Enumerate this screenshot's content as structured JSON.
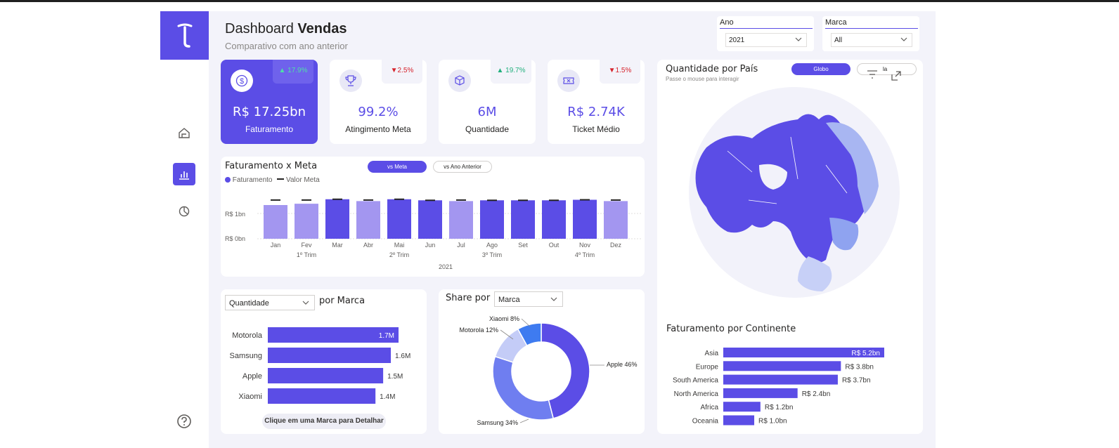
{
  "header": {
    "title_light": "Dashboard",
    "title_bold": "Vendas",
    "subtitle": "Comparativo com ano anterior"
  },
  "filters": {
    "ano": {
      "label": "Ano",
      "value": "2021"
    },
    "marca": {
      "label": "Marca",
      "value": "All"
    }
  },
  "nav": {
    "items": [
      "home-icon",
      "bar-chart-icon",
      "pie-chart-icon"
    ],
    "active": "bar-chart-icon",
    "help": "help-icon"
  },
  "kpis": [
    {
      "value": "R$ 17.25bn",
      "name": "Faturamento",
      "delta": "17.9%",
      "direction": "up",
      "icon": "dollar-icon"
    },
    {
      "value": "99.2%",
      "name": "Atingimento Meta",
      "delta": "2.5%",
      "direction": "down",
      "icon": "trophy-icon"
    },
    {
      "value": "6M",
      "name": "Quantidade",
      "delta": "19.7%",
      "direction": "up",
      "icon": "box-icon"
    },
    {
      "value": "R$ 2.74K",
      "name": "Ticket Médio",
      "delta": "1.5%",
      "direction": "down",
      "icon": "ticket-icon"
    }
  ],
  "colors": {
    "accent": "#5b4de6",
    "accent_light": "#a396f0",
    "up": "#22b07d",
    "down": "#d6232c"
  },
  "fat_meta": {
    "title": "Faturamento x Meta",
    "tab_active": "vs Meta",
    "tab_inactive": "vs Ano Anterior",
    "legend_fat": "Faturamento",
    "legend_meta": "Valor Meta",
    "y_ticks": [
      "R$ 1bn",
      "R$ 0bn"
    ],
    "quarters": [
      "1º Trim",
      "2º Trim",
      "3º Trim",
      "4º Trim"
    ],
    "year": "2021"
  },
  "marca": {
    "dropdown": "Quantidade",
    "title": "por Marca",
    "hint": "Clique em uma Marca para Detalhar"
  },
  "share": {
    "title": "Share por",
    "dropdown": "Marca"
  },
  "map": {
    "title": "Quantidade por País",
    "subtitle": "Passe o mouse para interagir",
    "tab_active": "Globo",
    "tab_inactive": "la"
  },
  "continente": {
    "title": "Faturamento por Continente"
  },
  "chart_data": [
    {
      "type": "bar",
      "title": "Faturamento x Meta",
      "categories": [
        "Jan",
        "Fev",
        "Mar",
        "Abr",
        "Mai",
        "Jun",
        "Jul",
        "Ago",
        "Set",
        "Out",
        "Nov",
        "Dez"
      ],
      "series": [
        {
          "name": "Faturamento",
          "values": [
            1.28,
            1.33,
            1.5,
            1.43,
            1.5,
            1.46,
            1.43,
            1.46,
            1.46,
            1.46,
            1.48,
            1.43
          ]
        },
        {
          "name": "Valor Meta",
          "values": [
            1.47,
            1.47,
            1.5,
            1.47,
            1.5,
            1.46,
            1.47,
            1.46,
            1.46,
            1.46,
            1.48,
            1.47
          ]
        }
      ],
      "highlight": [
        false,
        false,
        true,
        false,
        true,
        true,
        false,
        true,
        true,
        true,
        true,
        false
      ],
      "y_ticks": [
        "R$ 1bn",
        "R$ 0bn"
      ],
      "ylim": [
        0,
        1.6
      ]
    },
    {
      "type": "bar",
      "title": "por Marca",
      "categories": [
        "Motorola",
        "Samsung",
        "Apple",
        "Xiaomi"
      ],
      "values": [
        1.7,
        1.6,
        1.5,
        1.4
      ],
      "labels": [
        "1.7M",
        "1.6M",
        "1.5M",
        "1.4M"
      ]
    },
    {
      "type": "pie",
      "title": "Share por",
      "categories": [
        "Apple",
        "Samsung",
        "Motorola",
        "Xiaomi"
      ],
      "values": [
        46,
        34,
        12,
        8
      ],
      "labels": [
        "Apple 46%",
        "Samsung 34%",
        "Motorola 12%",
        "Xiaomi 8%"
      ],
      "colors": [
        "#5b4de6",
        "#6f7ef0",
        "#c4ccf7",
        "#3e7bf0"
      ]
    },
    {
      "type": "bar",
      "title": "Faturamento por Continente",
      "categories": [
        "Asia",
        "Europe",
        "South America",
        "North America",
        "Africa",
        "Oceania"
      ],
      "values": [
        5.2,
        3.8,
        3.7,
        2.4,
        1.2,
        1.0
      ],
      "labels": [
        "R$ 5.2bn",
        "R$ 3.8bn",
        "R$ 3.7bn",
        "R$ 2.4bn",
        "R$ 1.2bn",
        "R$ 1.0bn"
      ]
    }
  ]
}
